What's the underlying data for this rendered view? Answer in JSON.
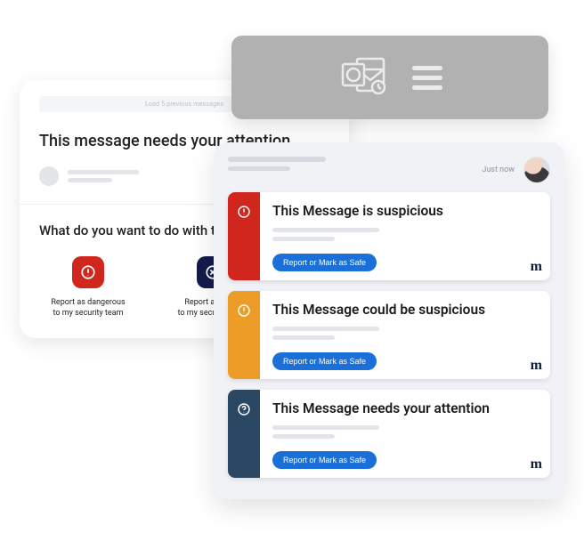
{
  "back_panel": {
    "load_text": "Load 5 previous messages",
    "title": "This message needs your attention",
    "subtitle": "What do you want to do with this message?",
    "actions": [
      {
        "label": "Report as dangerous\nto my security team",
        "color": "#d1261d",
        "icon": "exclaim"
      },
      {
        "label": "Report as spam\nto my security team",
        "color": "#151a4d",
        "icon": "cross"
      }
    ]
  },
  "top_bar": {
    "app_icon": "outlook-icon",
    "menu_icon": "hamburger-icon"
  },
  "front_panel": {
    "timestamp": "Just now",
    "cards": [
      {
        "stripe": "red",
        "icon": "exclaim-circle",
        "title": "This Message is suspicious",
        "button": "Report or Mark as Safe",
        "brand": "m"
      },
      {
        "stripe": "orange",
        "icon": "exclaim-circle",
        "title": "This Message could be suspicious",
        "button": "Report or Mark as Safe",
        "brand": "m"
      },
      {
        "stripe": "navy",
        "icon": "question-circle",
        "title": "This Message needs your attention",
        "button": "Report or Mark as Safe",
        "brand": "m"
      }
    ]
  }
}
